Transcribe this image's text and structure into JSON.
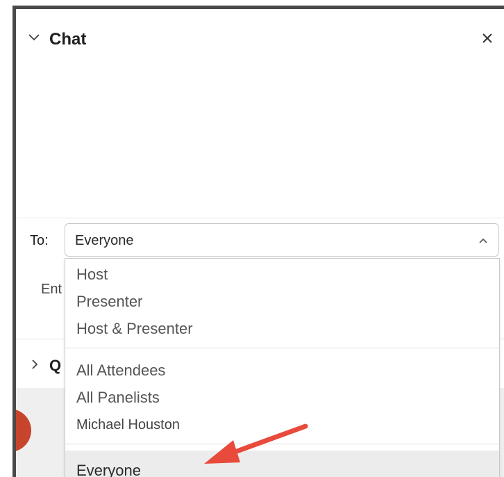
{
  "panel": {
    "title": "Chat",
    "collapse_icon": "chevron-down-icon",
    "close_icon": "close-icon"
  },
  "recipient": {
    "to_label": "To:",
    "selected_value": "Everyone",
    "dropdown_icon": "chevron-up-icon",
    "options_group1": [
      "Host",
      "Presenter",
      "Host & Presenter"
    ],
    "options_group2": [
      "All Attendees",
      "All Panelists",
      "Michael Houston"
    ],
    "options_group3": [
      "Everyone"
    ]
  },
  "message_input": {
    "partial_placeholder": "Ent"
  },
  "qa_section": {
    "label_partial": "Q",
    "expand_icon": "chevron-right-icon"
  },
  "colors": {
    "arrow": "#e84b3c",
    "avatar": "#c8452d"
  }
}
